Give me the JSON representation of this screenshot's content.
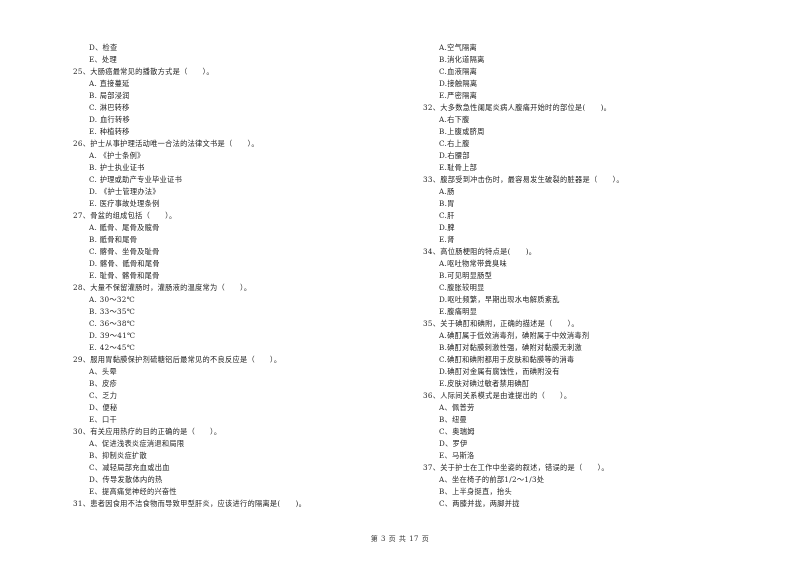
{
  "page": {
    "footer": "第 3 页 共 17 页"
  },
  "left_column": [
    {
      "type": "opt",
      "text": "D、检查"
    },
    {
      "type": "opt",
      "text": "E、处理"
    },
    {
      "type": "q",
      "text": "25、大肠癌最常见的播散方式是（　　）。"
    },
    {
      "type": "opt",
      "text": "A. 直接蔓延"
    },
    {
      "type": "opt",
      "text": "B. 局部浸润"
    },
    {
      "type": "opt",
      "text": "C. 淋巴转移"
    },
    {
      "type": "opt",
      "text": "D. 血行转移"
    },
    {
      "type": "opt",
      "text": "E. 种植转移"
    },
    {
      "type": "q",
      "text": "26、护士从事护理活动唯一合法的法律文书是（　　）。"
    },
    {
      "type": "opt",
      "text": "A. 《护士条例》"
    },
    {
      "type": "opt",
      "text": "B. 护士执业证书"
    },
    {
      "type": "opt",
      "text": "C. 护理或助产专业毕业证书"
    },
    {
      "type": "opt",
      "text": "D. 《护士管理办法》"
    },
    {
      "type": "opt",
      "text": "E. 医疗事故处理条例"
    },
    {
      "type": "q",
      "text": "27、骨盆的组成包括（　　）。"
    },
    {
      "type": "opt",
      "text": "A. 骶骨、尾骨及髋骨"
    },
    {
      "type": "opt",
      "text": "B. 骶骨和尾骨"
    },
    {
      "type": "opt",
      "text": "C. 髂骨、坐骨及耻骨"
    },
    {
      "type": "opt",
      "text": "D. 髂骨、骶骨和尾骨"
    },
    {
      "type": "opt",
      "text": "E. 耻骨、髂骨和尾骨"
    },
    {
      "type": "q",
      "text": "28、大量不保留灌肠时，灌肠液的温度常为（　　）。"
    },
    {
      "type": "opt",
      "text": "A. 30～32℃"
    },
    {
      "type": "opt",
      "text": "B. 33～35℃"
    },
    {
      "type": "opt",
      "text": "C. 36～38℃"
    },
    {
      "type": "opt",
      "text": "D. 39～41℃"
    },
    {
      "type": "opt",
      "text": "E. 42～45℃"
    },
    {
      "type": "q",
      "text": "29、服用胃黏膜保护剂硫糖铝后最常见的不良反应是（　　）。"
    },
    {
      "type": "opt",
      "text": "A、头晕"
    },
    {
      "type": "opt",
      "text": "B、皮疹"
    },
    {
      "type": "opt",
      "text": "C、乏力"
    },
    {
      "type": "opt",
      "text": "D、便秘"
    },
    {
      "type": "opt",
      "text": "E、口干"
    },
    {
      "type": "q",
      "text": "30、有关应用热疗的目的正确的是（　　）。"
    },
    {
      "type": "opt",
      "text": "A、促进浅表炎症消退和局限"
    },
    {
      "type": "opt",
      "text": "B、抑制炎症扩散"
    },
    {
      "type": "opt",
      "text": "C、减轻局部充血或出血"
    },
    {
      "type": "opt",
      "text": "D、传导发散体内的热"
    },
    {
      "type": "opt",
      "text": "E、提高痛觉神经的兴奋性"
    },
    {
      "type": "q",
      "text": "31、患者因食用不洁食物而导致甲型肝炎，应该进行的隔离是(　　)。"
    }
  ],
  "right_column": [
    {
      "type": "opt",
      "text": "A.空气隔离"
    },
    {
      "type": "opt",
      "text": "B.消化道隔离"
    },
    {
      "type": "opt",
      "text": "C.血液隔离"
    },
    {
      "type": "opt",
      "text": "D.接触隔离"
    },
    {
      "type": "opt",
      "text": "E.严密隔离"
    },
    {
      "type": "q",
      "text": "32、大多数急性阑尾炎病人腹痛开始时的部位是(　　)。"
    },
    {
      "type": "opt",
      "text": "A.右下腹"
    },
    {
      "type": "opt",
      "text": "B.上腹或脐周"
    },
    {
      "type": "opt",
      "text": "C.右上腹"
    },
    {
      "type": "opt",
      "text": "D.右腰部"
    },
    {
      "type": "opt",
      "text": "E.耻骨上部"
    },
    {
      "type": "q",
      "text": "33、腹部受到冲击伤时，最容易发生破裂的脏器是（　　）。"
    },
    {
      "type": "opt",
      "text": "A.肠"
    },
    {
      "type": "opt",
      "text": "B.胃"
    },
    {
      "type": "opt",
      "text": "C.肝"
    },
    {
      "type": "opt",
      "text": "D.脾"
    },
    {
      "type": "opt",
      "text": "E.肾"
    },
    {
      "type": "q",
      "text": "34、高位肠梗阻的特点是(　　)。"
    },
    {
      "type": "opt",
      "text": "A.呕吐物常带粪臭味"
    },
    {
      "type": "opt",
      "text": "B.可见明显肠型"
    },
    {
      "type": "opt",
      "text": "C.腹胀较明显"
    },
    {
      "type": "opt",
      "text": "D.呕吐频繁，早期出现水电解质紊乱"
    },
    {
      "type": "opt",
      "text": "E.腹痛明显"
    },
    {
      "type": "q",
      "text": "35、关于碘酊和碘附，正确的描述是（　　）。"
    },
    {
      "type": "opt",
      "text": "A.碘酊属于低效消毒剂，碘附属于中效消毒剂"
    },
    {
      "type": "opt",
      "text": "B.碘酊对黏膜刺激性强，碘附对黏膜无刺激"
    },
    {
      "type": "opt",
      "text": "C.碘酊和碘附都用于皮肤和黏膜等的消毒"
    },
    {
      "type": "opt",
      "text": "D.碘酊对金属有腐蚀性，而碘附没有"
    },
    {
      "type": "opt",
      "text": "E.皮肤对碘过敏者禁用碘酊"
    },
    {
      "type": "q",
      "text": "36、人际间关系模式是由谁提出的（　　）。"
    },
    {
      "type": "opt",
      "text": "A、佩普劳"
    },
    {
      "type": "opt",
      "text": "B、纽曼"
    },
    {
      "type": "opt",
      "text": "C、奥瑞姆"
    },
    {
      "type": "opt",
      "text": "D、罗伊"
    },
    {
      "type": "opt",
      "text": "E、马斯洛"
    },
    {
      "type": "q",
      "text": "37、关于护士在工作中坐姿的叙述，错误的是（　　）。"
    },
    {
      "type": "opt",
      "text": "A、坐在椅子的前部1/2～1/3处"
    },
    {
      "type": "opt",
      "text": "B、上半身挺直，抬头"
    },
    {
      "type": "opt",
      "text": "C、两膝并拢，两脚并拢"
    }
  ]
}
